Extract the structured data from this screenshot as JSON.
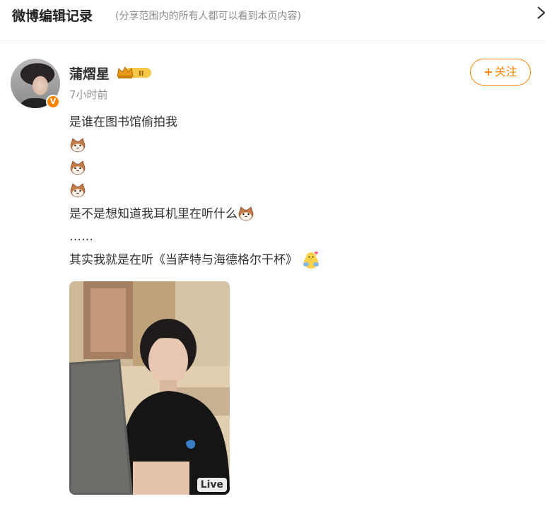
{
  "header": {
    "title": "微博编辑记录",
    "subtitle": "(分享范围内的所有人都可以看到本页内容)"
  },
  "post": {
    "author": "蒲熠星",
    "vip_level": "II",
    "verified_mark": "V",
    "time": "7小时前",
    "follow_label": "关注",
    "follow_plus": "+",
    "lines": {
      "l1": "是谁在图书馆偷拍我",
      "l5": "是不是想知道我耳机里在听什么",
      "l6": "……",
      "l7": "其实我就是在听《当萨特与海德格尔干杯》"
    },
    "image": {
      "live_label": "Live"
    }
  },
  "icons": {
    "close": "close-icon",
    "cat_emoji": "cat-face-emoji",
    "hug_emoji": "hugging-chick-emoji",
    "vip": "crown-vip-badge"
  },
  "colors": {
    "accent": "#ff8200",
    "text": "#333333",
    "muted": "#939393"
  }
}
